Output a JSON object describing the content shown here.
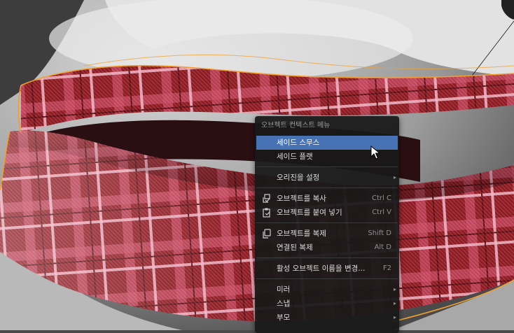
{
  "context_menu": {
    "title": "오브젝트 컨텍스트 메뉴",
    "items": [
      {
        "label": "세이드 스무스",
        "shortcut": "",
        "submenu": false
      },
      {
        "label": "세이드 플랫",
        "shortcut": "",
        "submenu": false
      },
      {
        "label": "오리진을 설정",
        "shortcut": "",
        "submenu": true
      },
      {
        "label": "오브젝트를 복사",
        "shortcut": "Ctrl C",
        "submenu": false,
        "icon": "copy-icon"
      },
      {
        "label": "오브젝트를 붙여 넣기",
        "shortcut": "Ctrl V",
        "submenu": false,
        "icon": "paste-icon"
      },
      {
        "label": "오브젝트를 복제",
        "shortcut": "Shift D",
        "submenu": false,
        "icon": "duplicate-icon"
      },
      {
        "label": "연결된 복제",
        "shortcut": "Alt D",
        "submenu": false
      },
      {
        "label": "활성 오브젝트 이름을 변경...",
        "shortcut": "F2",
        "submenu": false
      },
      {
        "label": "미러",
        "shortcut": "",
        "submenu": true
      },
      {
        "label": "스냅",
        "shortcut": "",
        "submenu": true
      },
      {
        "label": "부모",
        "shortcut": "",
        "submenu": true
      }
    ],
    "highlighted_index": 0,
    "submenu_glyph": "▸"
  },
  "colors": {
    "selection_outline": "#f0a030",
    "menu_background": "#181818",
    "highlight": "#4772b3",
    "fabric_red": "#8e1a22",
    "plaid_pink": "#e68aa0"
  }
}
